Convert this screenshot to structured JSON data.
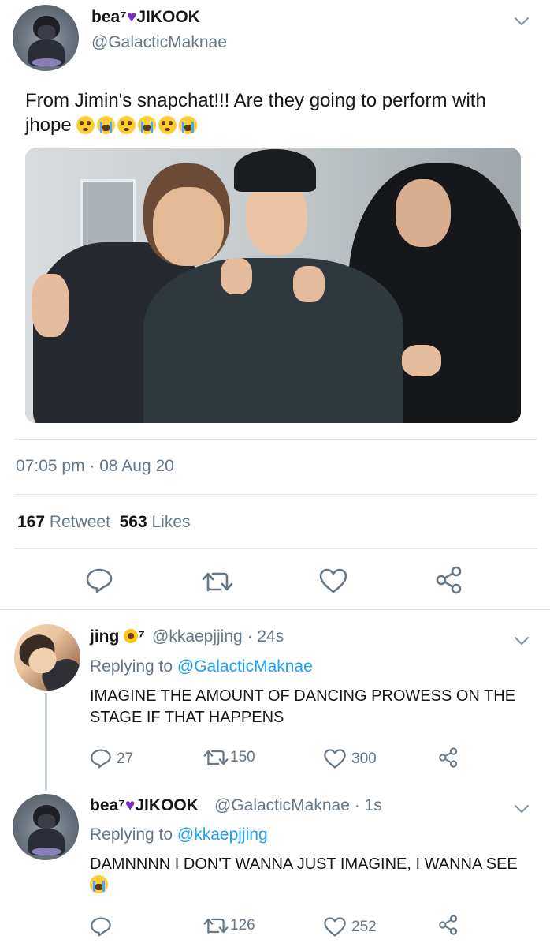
{
  "main_tweet": {
    "display_name_prefix": "bea⁷",
    "display_name_suffix": "JIKOOK",
    "handle": "@GalacticMaknae",
    "text": "From Jimin's snapchat!!! Are they going to perform with jhope",
    "timestamp": "07:05 pm · 08 Aug 20",
    "retweets": "167",
    "retweets_label": "Retweet",
    "likes": "563",
    "likes_label": "Likes"
  },
  "replies": [
    {
      "display_name": "jing",
      "superscript": "⁷",
      "handle_time": "@kkaepjjing · 24s",
      "replying_label": "Replying to ",
      "replying_to": "@GalacticMaknae",
      "text": "IMAGINE THE AMOUNT OF DANCING PROWESS ON THE STAGE IF THAT HAPPENS",
      "reply_count": "27",
      "retweet_count": "150",
      "like_count": "300"
    },
    {
      "display_name_prefix": "bea⁷",
      "display_name_suffix": "JIKOOK",
      "handle_time": "@GalacticMaknae · 1s",
      "replying_label": "Replying to ",
      "replying_to": "@kkaepjjing",
      "text": "DAMNNNN I DON'T WANNA JUST IMAGINE, I WANNA SEE",
      "reply_count": "",
      "retweet_count": "126",
      "like_count": "252"
    }
  ],
  "colors": {
    "text": "#14171a",
    "secondary": "#657786",
    "link": "#1da1f2",
    "heart_emoji": "#7b2fbe",
    "divider": "#e1e8ed"
  },
  "icons": [
    "chevron-down-icon",
    "reply-icon",
    "retweet-icon",
    "like-icon",
    "share-icon",
    "purple-heart-icon",
    "flushed-face-icon",
    "loudly-crying-face-icon",
    "sunflower-icon"
  ]
}
